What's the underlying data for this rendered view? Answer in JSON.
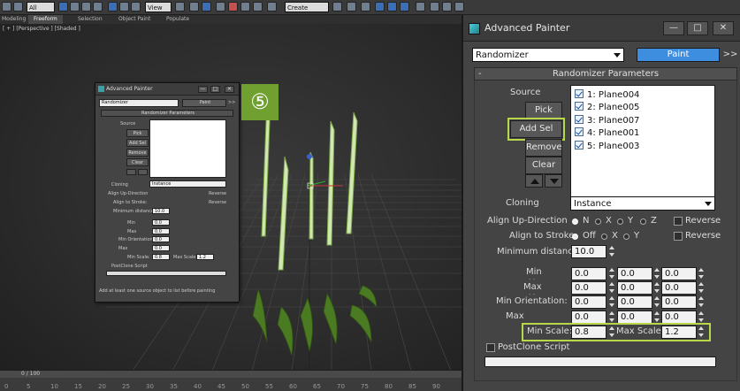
{
  "toolbar": {
    "menu_labels": [
      "Modeling",
      "Freeform",
      "Selection",
      "Object Paint",
      "Populate"
    ],
    "active_menu": "Freeform",
    "filter_value": "All",
    "view_value": "View",
    "selection_set_placeholder": "Create Selection S"
  },
  "viewport": {
    "label": "[ + ] [Perspective ] [Shaded ]"
  },
  "timeline": {
    "frame_indicator": "0 / 100",
    "ticks": [
      "0",
      "5",
      "10",
      "15",
      "20",
      "25",
      "30",
      "35",
      "40",
      "45",
      "50",
      "55",
      "60",
      "65",
      "70",
      "75",
      "80",
      "85",
      "90"
    ]
  },
  "step_badge": "⑤",
  "small_window": {
    "title": "Advanced Painter",
    "mode": "Randomizer",
    "paint_label": "Paint",
    "more_label": ">>",
    "rollout_title": "Randomizer Parameters",
    "source_label": "Source",
    "buttons": [
      "Pick",
      "Add Sel",
      "Remove",
      "Clear"
    ],
    "cloning_label": "Cloning",
    "cloning_value": "Instance",
    "align_up_label": "Align Up-Direction",
    "align_stroke_label": "Align to Stroke:",
    "reverse_label": "Reverse",
    "min_distance_label": "Minimum distance:",
    "min_distance_value": "10.0",
    "min_label": "Min",
    "max_label": "Max",
    "min_orient_label": "Min Orientation:",
    "max2_label": "Max",
    "min_scale_label": "Min Scale:",
    "min_scale_value": "0.8",
    "max_scale_label": "Max Scale:",
    "max_scale_value": "1.2",
    "postclone_label": "PostClone Script",
    "status_text": "Add at least one source object to list before painting",
    "spin_value": "0.0"
  },
  "panel": {
    "title": "Advanced Painter",
    "win_controls": [
      "—",
      "□",
      "✕"
    ],
    "mode_value": "Randomizer",
    "paint_label": "Paint",
    "more_label": ">>",
    "rollout_title": "Randomizer Parameters",
    "rollout_toggle": "-",
    "source_label": "Source",
    "pick_label": "Pick",
    "add_sel_label": "Add Sel",
    "remove_label": "Remove",
    "clear_label": "Clear",
    "source_items": [
      "1: Plane004",
      "2: Plane005",
      "3: Plane007",
      "4: Plane001",
      "5: Plane003"
    ],
    "cloning_label": "Cloning",
    "cloning_value": "Instance",
    "align_up_label": "Align Up-Direction",
    "axis_none": "N",
    "axis_x": "X",
    "axis_y": "Y",
    "axis_z": "Z",
    "reverse_label": "Reverse",
    "align_stroke_label": "Align to Stroke:",
    "stroke_off": "Off",
    "min_distance_label": "Minimum distance:",
    "min_distance_value": "10.0",
    "min_label": "Min",
    "max_label": "Max",
    "min_orient_label": "Min Orientation:",
    "max2_label": "Max",
    "spin_value": "0.0",
    "min_scale_label": "Min Scale:",
    "min_scale_value": "0.8",
    "max_scale_label": "Max Scale:",
    "max_scale_value": "1.2",
    "postclone_label": "PostClone Script",
    "highlight_color": "#b6d84a",
    "paint_color": "#3e8ee0"
  }
}
